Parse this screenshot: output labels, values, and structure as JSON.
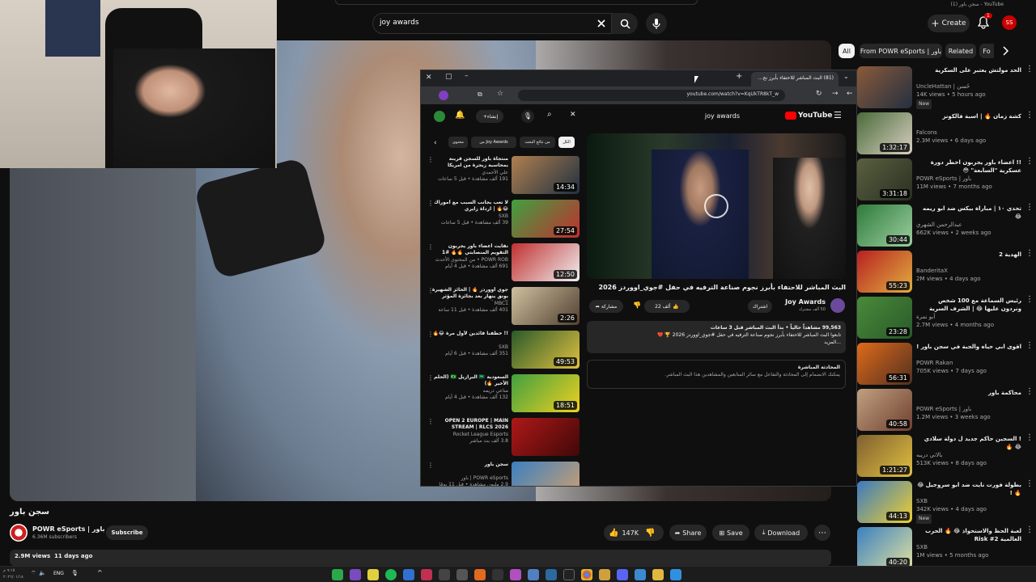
{
  "browser": {
    "tab_title": "YouTube - سجن باور (1)",
    "search_value": "joy awards"
  },
  "header": {
    "create_label": "Create",
    "notif_count": "1",
    "avatar_initials": "SS"
  },
  "chips": [
    "All",
    "From POWR eSports | باور",
    "Related",
    "Fo"
  ],
  "video": {
    "title": "سجن باور",
    "channel": "POWR eSports | باور",
    "subs": "6.36M subscribers",
    "subscribe_label": "Subscribe",
    "likes": "147K",
    "share_label": "Share",
    "save_label": "Save",
    "download_label": "Download",
    "views_line": "2.9M views  11 days ago"
  },
  "recommendations": [
    {
      "title": "الحد مولتش يعتبر على السكرية",
      "channel": "UncleHattan | حُسن",
      "meta": "14K views • 5 hours ago",
      "badge": "New",
      "dur": "",
      "c1": "#8a5a3a",
      "c2": "#243040"
    },
    {
      "title": "كشة زمان 🔥 | اسبة فالكونز",
      "channel": "Falcons",
      "meta": "2.3M views • 6 days ago",
      "badge": "",
      "dur": "1:32:17",
      "c1": "#4a6a3a",
      "c2": "#d8d0c0"
    },
    {
      "title": "!! اعضاء باور يجربون اخطر دورة عسكرية \"السابعة\" 😳",
      "channel": "POWR eSports | باور",
      "meta": "11M views • 7 months ago",
      "badge": "",
      "dur": "3:31:18",
      "c1": "#5a6040",
      "c2": "#2a2f22"
    },
    {
      "title": "تحدي ١٠ | مباراة بيكس ضد ابو ريمه 😂",
      "channel": "عبدالرحمن الشهري",
      "meta": "662K views • 2 weeks ago",
      "badge": "",
      "dur": "30:44",
      "c1": "#2f7a3a",
      "c2": "#9bd0a0"
    },
    {
      "title": "الهدية 2",
      "channel": "BanderitaX",
      "meta": "2M views • 4 days ago",
      "badge": "",
      "dur": "55:23",
      "c1": "#b82020",
      "c2": "#e0b040"
    },
    {
      "title": "رئيس السماعة مع 100 شخص ونردون عليها 😂 | الشرف السرية",
      "channel": "أبو نمرة",
      "meta": "2.7M views • 4 months ago",
      "badge": "",
      "dur": "23:28",
      "c1": "#4a8a3a",
      "c2": "#2a5a2a"
    },
    {
      "title": "اقوى ابي حياه والجبة في سجن باور !",
      "channel": "POWR Rakan",
      "meta": "705K views • 7 days ago",
      "badge": "",
      "dur": "56:31",
      "c1": "#e06a1a",
      "c2": "#503020"
    },
    {
      "title": "محاكمة باور",
      "channel": "POWR eSports | باور",
      "meta": "1.2M views • 3 weeks ago",
      "badge": "",
      "dur": "40:58",
      "c1": "#c0a080",
      "c2": "#704030"
    },
    {
      "title": "! السجين حاكم جديد ل دولة سلادي 😂 🔥",
      "channel": "بالاتي دريبه",
      "meta": "513K views • 8 days ago",
      "badge": "",
      "dur": "1:21:27",
      "c1": "#806030",
      "c2": "#e0c040"
    },
    {
      "title": "بطولة فورت نايت ضد ابو سروجيل 😂 🔥 !",
      "channel": "SXB",
      "meta": "342K views • 4 days ago",
      "badge": "New",
      "dur": "44:13",
      "c1": "#3a7ac0",
      "c2": "#f0d030"
    },
    {
      "title": "لعبة الحظ والاستحواذ 😂 🔥 الحرب العالمية Risk #2",
      "channel": "SXB",
      "meta": "1M views • 5 months ago",
      "badge": "",
      "dur": "40:20",
      "c1": "#3a80c0",
      "c2": "#e0e0a0"
    }
  ],
  "popup": {
    "tab_title": "(81) البث المباشر للاحتفاء بأبرز نج...",
    "url": "youtube.com/watch?v=KqUkTR8kT_w",
    "search_value": "joy awards",
    "logo_label": "YouTube",
    "create_label": "إنشاء",
    "video_title": "البث المباشر للاحتفاء بأبرز نجوم صناعة الترفيه في حفل #جوي_اووردز 2026",
    "channel": "Joy Awards",
    "subs": "50 ألف مشترك",
    "join_label": "اشتراك",
    "likes": "22 ألف",
    "share_label": "مشاركة",
    "desc_line1": "99,563 مشاهداً حالياً • بدأ البث المباشر قبل 3 ساعات",
    "desc_line2": "تابعوا البث المباشر للاحتفاء بأبرز نجوم صناعة الترفيه في حفل #جوي_اووردز 2026 🏆 ❤️",
    "desc_more": "...المزيد",
    "chat_title": "المحادثة المباشرة",
    "chat_text": "يمكنك الانضمام إلى المحادثة والتفاعل مع سائر المتابعين والمشاهدين هذا البث المباشر.",
    "chips": [
      "الكل",
      "من نتائج البحث",
      "من Joy Awards",
      "محتوى"
    ],
    "recs": [
      {
        "title": "منتجاة باور للسجن قرينة بمحاسبة زيجرة من امريكا",
        "channel": "علي الأحمدي",
        "meta": "191 ألف مشاهدة • قبل 5 ساعات",
        "dur": "14:34",
        "c1": "#b08050",
        "c2": "#203040"
      },
      {
        "title": "لا تغب بجانب السبب مع أموراك 😂🔥 | ارداة زايري",
        "channel": "SXB",
        "meta": "39 ألف مشاهدة • قبل 5 ساعات",
        "dur": "27:54",
        "c1": "#40a040",
        "c2": "#c03030"
      },
      {
        "title": "نفايت أعضاء باور يجربون التقويم المنصابتي 🔥🔥 #1",
        "channel": "POWR ROB • من المحتوى الأحدث",
        "meta": "691 ألف مشاهدة • قبل 4 أيام",
        "dur": "12:50",
        "c1": "#c03030",
        "c2": "#f0f0f0"
      },
      {
        "title": "جوي أووردز 🔥 | الحائز الشهيرة بونق ينهار بعد بجائزة المؤثر المفضل",
        "channel": "MBC1",
        "meta": "401 ألف مشاهدة • قبل 11 ساعة",
        "dur": "2:26",
        "c1": "#d0c0a0",
        "c2": "#504030"
      },
      {
        "title": "!! خطفنا قائدين لأول مرة 😂🔥",
        "channel": "SXB",
        "meta": "351 ألف مشاهدة • قبل 6 أيام",
        "dur": "49:53",
        "c1": "#2a5a2a",
        "c2": "#e0c040"
      },
      {
        "title": "السعودية 🇸🇦 البرازيل 🇧🇷 (الحلم الأخير 🔥)",
        "channel": "مناعي دريمه",
        "meta": "132 ألف مشاهدة • قبل 4 أيام",
        "dur": "18:51",
        "c1": "#40a040",
        "c2": "#f0d020"
      },
      {
        "title": "OPEN 2 EUROPE | MAIN STREAM | RLCS 2026",
        "channel": "Rocket League Esports",
        "meta": "3.8 ألف بث مباشر",
        "dur": "",
        "c1": "#b01818",
        "c2": "#400808"
      },
      {
        "title": "سجن باور",
        "channel": "POWR eSports | باور",
        "meta": "2.9 مليون مشاهدة • قبل 11 يومًا",
        "dur": "",
        "c1": "#3a80c0",
        "c2": "#d0a070"
      }
    ]
  },
  "taskbar": {
    "lang": "ENG",
    "time": "٩:١٥ م",
    "date": "٢٠٢٦/٠١/١٨"
  },
  "colors": {
    "accent": "#cc0000",
    "subscribe_bg": "#272727",
    "bg": "#0f0f0f"
  }
}
